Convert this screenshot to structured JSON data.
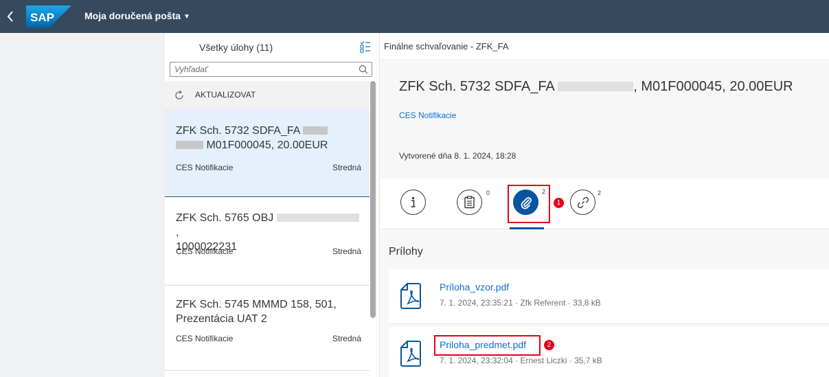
{
  "shell": {
    "back_icon": "chevron-left-icon",
    "logo_text": "SAP",
    "title": "Moja doručená pošta",
    "title_caret": "▼"
  },
  "master": {
    "title": "Všetky úlohy (11)",
    "sort_icon": "sort-icon",
    "search_placeholder": "Vyhľadať",
    "refresh_label": "AKTUALIZOVAT",
    "items": [
      {
        "title_line1": "ZFK Sch. 5732 SDFA_FA",
        "title_line2": "M01F000045, 20.00EUR",
        "subtitle": "CES Notifikacie",
        "priority": "Stredná"
      },
      {
        "title_line1": "ZFK Sch. 5765 OBJ",
        "title_line1_end": ",",
        "title_line2": "1000022231",
        "subtitle": "CES Notifikacie",
        "priority": "Stredná"
      },
      {
        "title_line1": "ZFK Sch. 5745 MMMD 158, 501,",
        "title_line2": "Prezentácia UAT 2",
        "subtitle": "CES Notifikacie",
        "priority": "Stredná"
      }
    ]
  },
  "detail": {
    "top_title": "Finálne schvaľovanie - ZFK_FA",
    "heading_start": "ZFK Sch. 5732 SDFA_FA",
    "heading_end": ", M01F000045, 20.00EUR",
    "link": "CES Notifikacie",
    "created": "Vytvorené dňa 8. 1. 2024, 18:28",
    "tabs": [
      {
        "icon": "info-icon",
        "count": ""
      },
      {
        "icon": "notes-icon",
        "count": "0"
      },
      {
        "icon": "paperclip-icon",
        "count": "2"
      },
      {
        "icon": "link-icon",
        "count": "2"
      }
    ],
    "attachments_heading": "Prílohy",
    "attachments": [
      {
        "name": "Príloha_vzor.pdf",
        "meta": "7. 1. 2024, 23:35:21 · Zfk Referent · 33,8 kB"
      },
      {
        "name": "Priloha_predmet.pdf",
        "meta": "7. 1. 2024, 23:32:04 · Ernest Liczki · 35,7 kB"
      }
    ]
  },
  "markers": [
    "1",
    "2"
  ],
  "colors": {
    "shell": "#354a5f",
    "accent": "#0854a0",
    "link": "#0a6ed1",
    "highlight": "#e2001a"
  }
}
